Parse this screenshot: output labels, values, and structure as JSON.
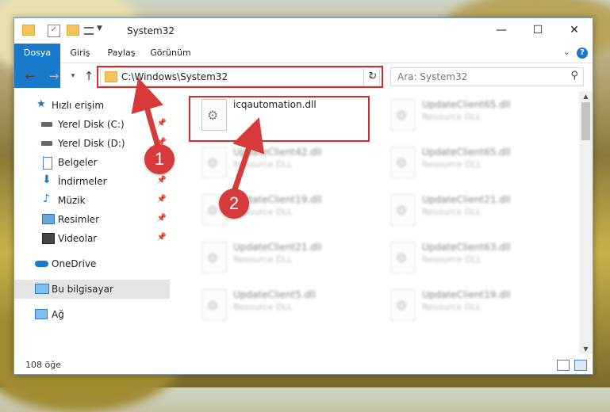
{
  "window": {
    "title": "System32",
    "controls": {
      "minimize": "—",
      "maximize": "☐",
      "close": "✕"
    }
  },
  "ribbon": {
    "tabs": [
      "Dosya",
      "Giriş",
      "Paylaş",
      "Görünüm"
    ],
    "help": "?"
  },
  "nav": {
    "address": "C:\\Windows\\System32",
    "search_placeholder": "Ara: System32"
  },
  "sidebar": {
    "items": [
      {
        "label": "Hızlı erişim",
        "icon": "star-icon",
        "pinned": false
      },
      {
        "label": "Yerel Disk (C:)",
        "icon": "drive-icon",
        "pinned": true
      },
      {
        "label": "Yerel Disk (D:)",
        "icon": "drive-icon",
        "pinned": true
      },
      {
        "label": "Belgeler",
        "icon": "documents-icon",
        "pinned": true
      },
      {
        "label": "İndirmeler",
        "icon": "download-icon",
        "pinned": true
      },
      {
        "label": "Müzik",
        "icon": "music-icon",
        "pinned": true
      },
      {
        "label": "Resimler",
        "icon": "pictures-icon",
        "pinned": true
      },
      {
        "label": "Videolar",
        "icon": "videos-icon",
        "pinned": true
      },
      {
        "label": "OneDrive",
        "icon": "onedrive-icon",
        "pinned": false
      },
      {
        "label": "Bu bilgisayar",
        "icon": "computer-icon",
        "pinned": false
      },
      {
        "label": "Ağ",
        "icon": "network-icon",
        "pinned": false
      }
    ],
    "pin": "📌"
  },
  "files": {
    "highlighted": {
      "name": "icqautomation.dll",
      "type": ""
    },
    "col1": [
      {
        "name": "UpdateClient42.dll",
        "type": "Resource DLL"
      },
      {
        "name": "UpdateClient19.dll",
        "type": "Resource DLL"
      },
      {
        "name": "UpdateClient21.dll",
        "type": "Resource DLL"
      },
      {
        "name": "UpdateClient5.dll",
        "type": "Resource DLL"
      }
    ],
    "col2": [
      {
        "name": "UpdateClient65.dll",
        "type": "Resource DLL"
      },
      {
        "name": "UpdateClient65.dll",
        "type": "Resource DLL"
      },
      {
        "name": "UpdateClient21.dll",
        "type": "Resource DLL"
      },
      {
        "name": "UpdateClient63.dll",
        "type": "Resource DLL"
      },
      {
        "name": "UpdateClient19.dll",
        "type": "Resource DLL"
      }
    ]
  },
  "status": {
    "count": "108 öğe"
  },
  "annotations": {
    "step1": "1",
    "step2": "2"
  },
  "colors": {
    "accent": "#1979ca",
    "highlight": "#d92a2a"
  }
}
